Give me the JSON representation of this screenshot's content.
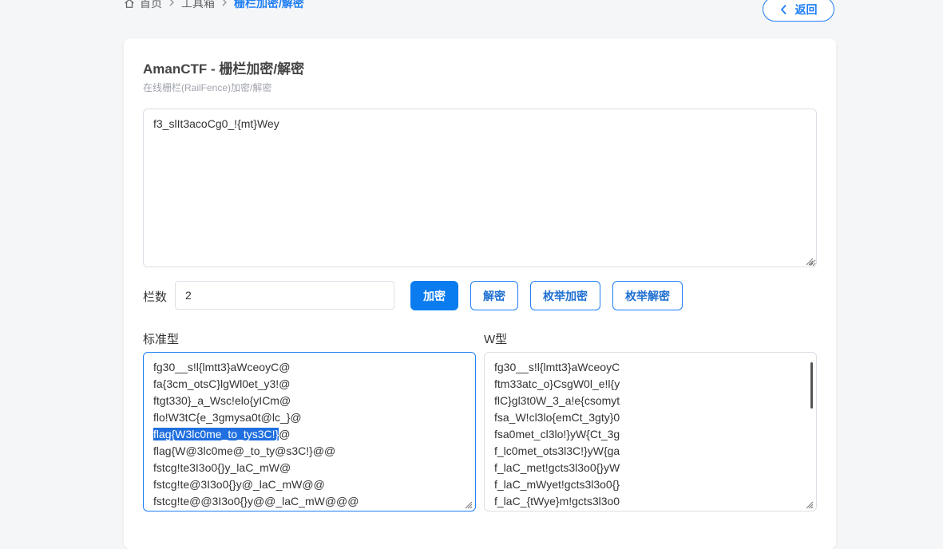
{
  "breadcrumb": {
    "home": "首页",
    "toolbox": "工具箱",
    "current": "栅栏加密/解密"
  },
  "back_button": {
    "label": "返回"
  },
  "card": {
    "title": "AmanCTF - 栅栏加密/解密",
    "subtitle": "在线栅栏(RailFence)加密/解密"
  },
  "input": {
    "value": "f3_slIt3acoCg0_!{mt}Wey"
  },
  "rails": {
    "label": "栏数",
    "value": "2"
  },
  "buttons": {
    "encrypt": "加密",
    "decrypt": "解密",
    "enum_encrypt": "枚举加密",
    "enum_decrypt": "枚举解密"
  },
  "standard": {
    "label": "标准型",
    "lines": [
      "fg30__s!l{lmtt3}aWceoyC@",
      "fa{3cm_otsC}lgWl0et_y3!@",
      "ftgt330}_a_Wsc!elo{yICm@",
      "flo!W3tC{e_3gmysa0t@lc_}@",
      "flag{W3lc0me_to_tys3C!}@",
      "flag{W@3lc0me@_to_ty@s3C!}@@",
      "fstcg!te3I3o0{}y_laC_mW@",
      "fstcg!te@3I3o0{}y@_laC_mW@@",
      "fstcg!te@@3I3o0{}y@@_laC_mW@@@"
    ],
    "highlight_line": {
      "selected": "flag{W3lc0me_to_tys3C!}",
      "rest": "@"
    }
  },
  "w_type": {
    "label": "W型",
    "lines": [
      "fg30__s!l{lmtt3}aWceoyC",
      "ftm33atc_o}CsgW0l_e!l{y",
      "flC}gl3t0W_3_a!e{csomyt",
      "fsa_W!cl3lo{emCt_3gty}0",
      "fsa0met_cl3lo!}yW{Ct_3g",
      "f_lc0met_ots3l3C!}yW{ga",
      "f_laC_met!gcts3l3o0{}yW",
      "f_laC_mWyet!gcts3l3o0{}",
      "f_laC_{tWye}m!gcts3l3o0"
    ]
  }
}
